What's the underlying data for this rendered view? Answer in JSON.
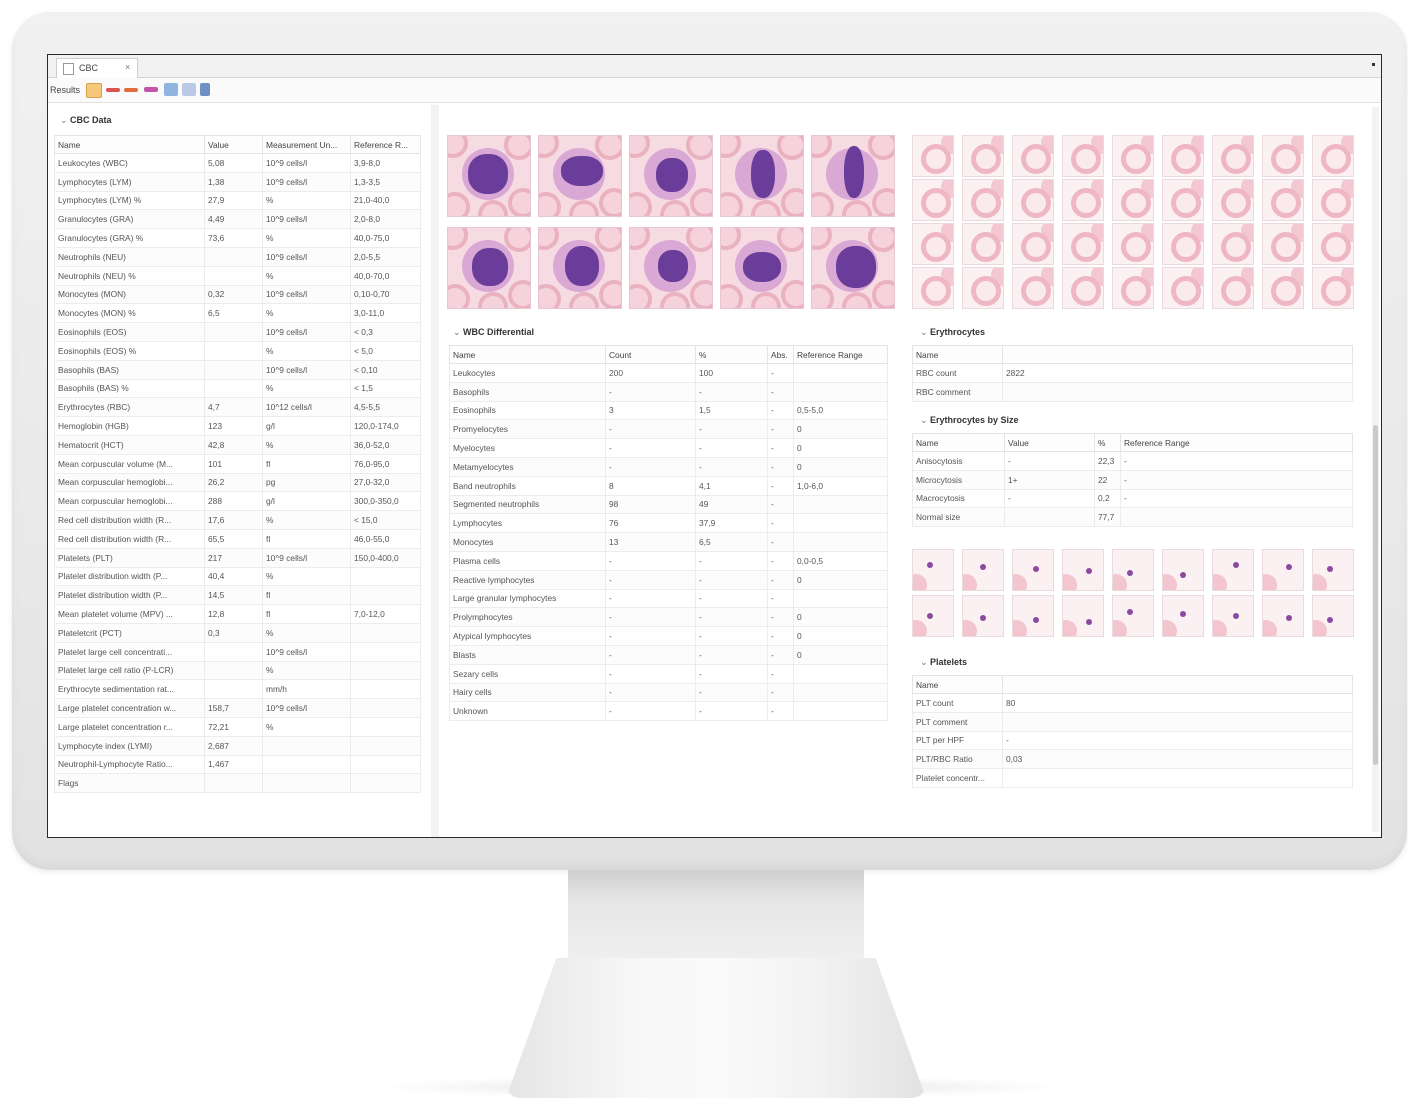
{
  "app": {
    "tab_title": "CBC",
    "tab_close": "×",
    "toolbar_label": "Results"
  },
  "colors": {
    "accent": "#6b3d9a",
    "rbc_pink": "#efb7c4",
    "grid_border": "#e4e4e4"
  },
  "icons": [
    "document-icon",
    "close-icon",
    "tool-icon",
    "chart-icon"
  ],
  "cbc": {
    "title": "CBC Data",
    "columns": [
      "Name",
      "Value",
      "Measurement Un...",
      "Reference R..."
    ],
    "rows": [
      [
        "Leukocytes (WBC)",
        "5,08",
        "10^9 cells/l",
        "3,9-8,0"
      ],
      [
        "Lymphocytes (LYM)",
        "1,38",
        "10^9 cells/l",
        "1,3-3,5"
      ],
      [
        "Lymphocytes (LYM) %",
        "27,9",
        "%",
        "21,0-40,0"
      ],
      [
        "Granulocytes (GRA)",
        "4,49",
        "10^9 cells/l",
        "2,0-8,0"
      ],
      [
        "Granulocytes (GRA) %",
        "73,6",
        "%",
        "40,0-75,0"
      ],
      [
        "Neutrophils (NEU)",
        "",
        "10^9 cells/l",
        "2,0-5,5"
      ],
      [
        "Neutrophils (NEU) %",
        "",
        "%",
        "40,0-70,0"
      ],
      [
        "Monocytes (MON)",
        "0,32",
        "10^9 cells/l",
        "0,10-0,70"
      ],
      [
        "Monocytes (MON) %",
        "6,5",
        "%",
        "3,0-11,0"
      ],
      [
        "Eosinophils (EOS)",
        "",
        "10^9 cells/l",
        "< 0,3"
      ],
      [
        "Eosinophils (EOS) %",
        "",
        "%",
        "< 5,0"
      ],
      [
        "Basophils (BAS)",
        "",
        "10^9 cells/l",
        "< 0,10"
      ],
      [
        "Basophils (BAS) %",
        "",
        "%",
        "< 1,5"
      ],
      [
        "Erythrocytes (RBC)",
        "4,7",
        "10^12 cells/l",
        "4,5-5,5"
      ],
      [
        "Hemoglobin (HGB)",
        "123",
        "g/l",
        "120,0-174,0"
      ],
      [
        "Hematocrit (HCT)",
        "42,8",
        "%",
        "36,0-52,0"
      ],
      [
        "Mean corpuscular volume (M...",
        "101",
        "fl",
        "76,0-95,0"
      ],
      [
        "Mean corpuscular hemoglobi...",
        "26,2",
        "pg",
        "27,0-32,0"
      ],
      [
        "Mean corpuscular hemoglobi...",
        "288",
        "g/l",
        "300,0-350,0"
      ],
      [
        "Red cell distribution width (R...",
        "17,6",
        "%",
        "< 15,0"
      ],
      [
        "Red cell distribution width (R...",
        "65,5",
        "fl",
        "46,0-55,0"
      ],
      [
        "Platelets (PLT)",
        "217",
        "10^9 cells/l",
        "150,0-400,0"
      ],
      [
        "Platelet distribution width (P...",
        "40,4",
        "%",
        ""
      ],
      [
        "Platelet distribution width (P...",
        "14,5",
        "fl",
        ""
      ],
      [
        "Mean platelet volume (MPV) ...",
        "12,8",
        "fl",
        "7,0-12,0"
      ],
      [
        "Plateletcrit (PCT)",
        "0,3",
        "%",
        ""
      ],
      [
        "Platelet large cell concentrati...",
        "",
        "10^9 cells/l",
        ""
      ],
      [
        "Platelet large cell ratio (P-LCR)",
        "",
        "%",
        ""
      ],
      [
        "Erythrocyte sedimentation rat...",
        "",
        "mm/h",
        ""
      ],
      [
        "Large platelet concentration w...",
        "158,7",
        "10^9 cells/l",
        ""
      ],
      [
        "Large platelet concentration r...",
        "72,21",
        "%",
        ""
      ],
      [
        "Lymphocyte index (LYMI)",
        "2,687",
        "",
        ""
      ],
      [
        "Neutrophil-Lymphocyte Ratio...",
        "1,467",
        "",
        ""
      ],
      [
        "Flags",
        "",
        "",
        ""
      ]
    ]
  },
  "wbc": {
    "title": "WBC Differential",
    "columns": [
      "Name",
      "Count",
      "%",
      "Abs.",
      "Reference Range"
    ],
    "rows": [
      [
        "Leukocytes",
        "200",
        "100",
        "-",
        ""
      ],
      [
        "Basophils",
        "-",
        "-",
        "-",
        ""
      ],
      [
        "Eosinophils",
        "3",
        "1,5",
        "-",
        "0,5-5,0"
      ],
      [
        "Promyelocytes",
        "-",
        "-",
        "-",
        "0"
      ],
      [
        "Myelocytes",
        "-",
        "-",
        "-",
        "0"
      ],
      [
        "Metamyelocytes",
        "-",
        "-",
        "-",
        "0"
      ],
      [
        "Band neutrophils",
        "8",
        "4,1",
        "-",
        "1,0-6,0"
      ],
      [
        "Segmented neutrophils",
        "98",
        "49",
        "-",
        ""
      ],
      [
        "Lymphocytes",
        "76",
        "37,9",
        "-",
        ""
      ],
      [
        "Monocytes",
        "13",
        "6,5",
        "-",
        ""
      ],
      [
        "Plasma cells",
        "-",
        "-",
        "-",
        "0,0-0,5"
      ],
      [
        "Reactive lymphocytes",
        "-",
        "-",
        "-",
        "0"
      ],
      [
        "Large granular lymphocytes",
        "-",
        "-",
        "-",
        ""
      ],
      [
        "Prolymphocytes",
        "-",
        "-",
        "-",
        "0"
      ],
      [
        "Atypical lymphocytes",
        "-",
        "-",
        "-",
        "0"
      ],
      [
        "Blasts",
        "-",
        "-",
        "-",
        "0"
      ],
      [
        "Sezary cells",
        "-",
        "-",
        "-",
        ""
      ],
      [
        "Hairy cells",
        "-",
        "-",
        "-",
        ""
      ],
      [
        "Unknown",
        "-",
        "-",
        "-",
        ""
      ]
    ]
  },
  "erythrocytes": {
    "title": "Erythrocytes",
    "columns": [
      "Name",
      ""
    ],
    "rows": [
      [
        "RBC count",
        "2822"
      ],
      [
        "RBC comment",
        ""
      ]
    ]
  },
  "erythro_size": {
    "title": "Erythrocytes by Size",
    "columns": [
      "Name",
      "Value",
      "%",
      "Reference Range"
    ],
    "rows": [
      [
        "Anisocytosis",
        "-",
        "22,3",
        "-"
      ],
      [
        "Microcytosis",
        "1+",
        "22",
        "-"
      ],
      [
        "Macrocytosis",
        "-",
        "0,2",
        "-"
      ],
      [
        "Normal size",
        "",
        "77,7",
        ""
      ]
    ]
  },
  "platelets": {
    "title": "Platelets",
    "columns": [
      "Name",
      ""
    ],
    "rows": [
      [
        "PLT count",
        "80"
      ],
      [
        "PLT comment",
        ""
      ],
      [
        "PLT per HPF",
        "-"
      ],
      [
        "PLT/RBC Ratio",
        "0,03"
      ],
      [
        "Platelet concentr...",
        ""
      ]
    ]
  }
}
